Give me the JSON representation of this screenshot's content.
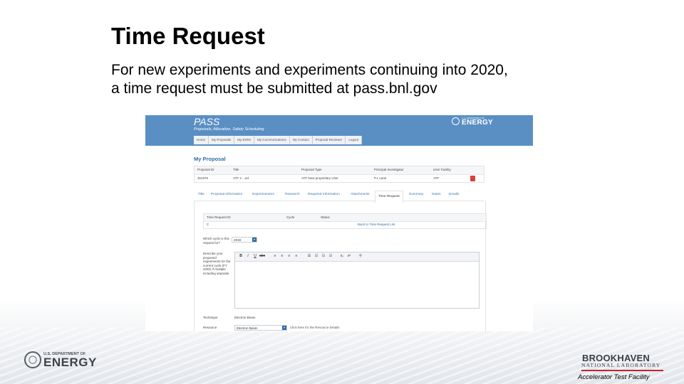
{
  "slide": {
    "title": "Time Request",
    "body_line1": "For new experiments and experiments continuing into 2020,",
    "body_line2": "a time request must be submitted at pass.bnl.gov"
  },
  "screenshot": {
    "app_title": "PASS",
    "app_subtitle": "Proposals, Allocation, Safety Scheduling",
    "doe_small": "U.S. DEPARTMENT OF",
    "doe_big": "ENERGY",
    "nav": [
      "Home",
      "My Proposals",
      "My ESRs",
      "My Communications",
      "My Contact",
      "Proposal Reviewer",
      "Logout"
    ],
    "section_title": "My Proposal",
    "proposal_table": {
      "headers": [
        "Proposal ID",
        "Title",
        "Proposal Type",
        "Principal Investigator",
        "User Facility"
      ],
      "values": [
        "301975",
        "ATF 2 ...ed",
        "ATF New proprietary User",
        "P.I. Lane",
        "ATF"
      ]
    },
    "tabs": [
      "Title",
      "Proposal Information",
      "Experimenters",
      "Research",
      "Required Information",
      "Attachments",
      "Time Request",
      "Summary",
      "Notes",
      "Emails"
    ],
    "active_tab": "Time Request",
    "time_request_table": {
      "headers": [
        "Time Request ID",
        "Cycle",
        "Status"
      ],
      "row_first": "C",
      "link": "Back to Time Request List"
    },
    "cycle_label": "Which cycle is this request for?",
    "cycle_value": "2019",
    "experiments_label": "Describe your proposed experiments for the current cycle (FY 2020) if multiple including separate",
    "toolbar": [
      "B",
      "I",
      "U",
      "abc",
      "≡",
      "≡",
      "≡",
      "≡",
      "☰",
      "☷",
      "☷",
      "☷",
      "x₂",
      "x²",
      "⚲"
    ],
    "technique_label": "Technique",
    "technique_value": "Electron Beam",
    "resource_label": "Resource",
    "resource_value": "Electron Beam",
    "resource_note": "Click here for the Resource Details"
  },
  "footer": {
    "doe_small": "U.S. DEPARTMENT OF",
    "doe_big": "ENERGY",
    "bnl_name": "BROOKHAVEN",
    "bnl_lab": "NATIONAL LABORATORY",
    "facility": "Accelerator Test Facility"
  }
}
